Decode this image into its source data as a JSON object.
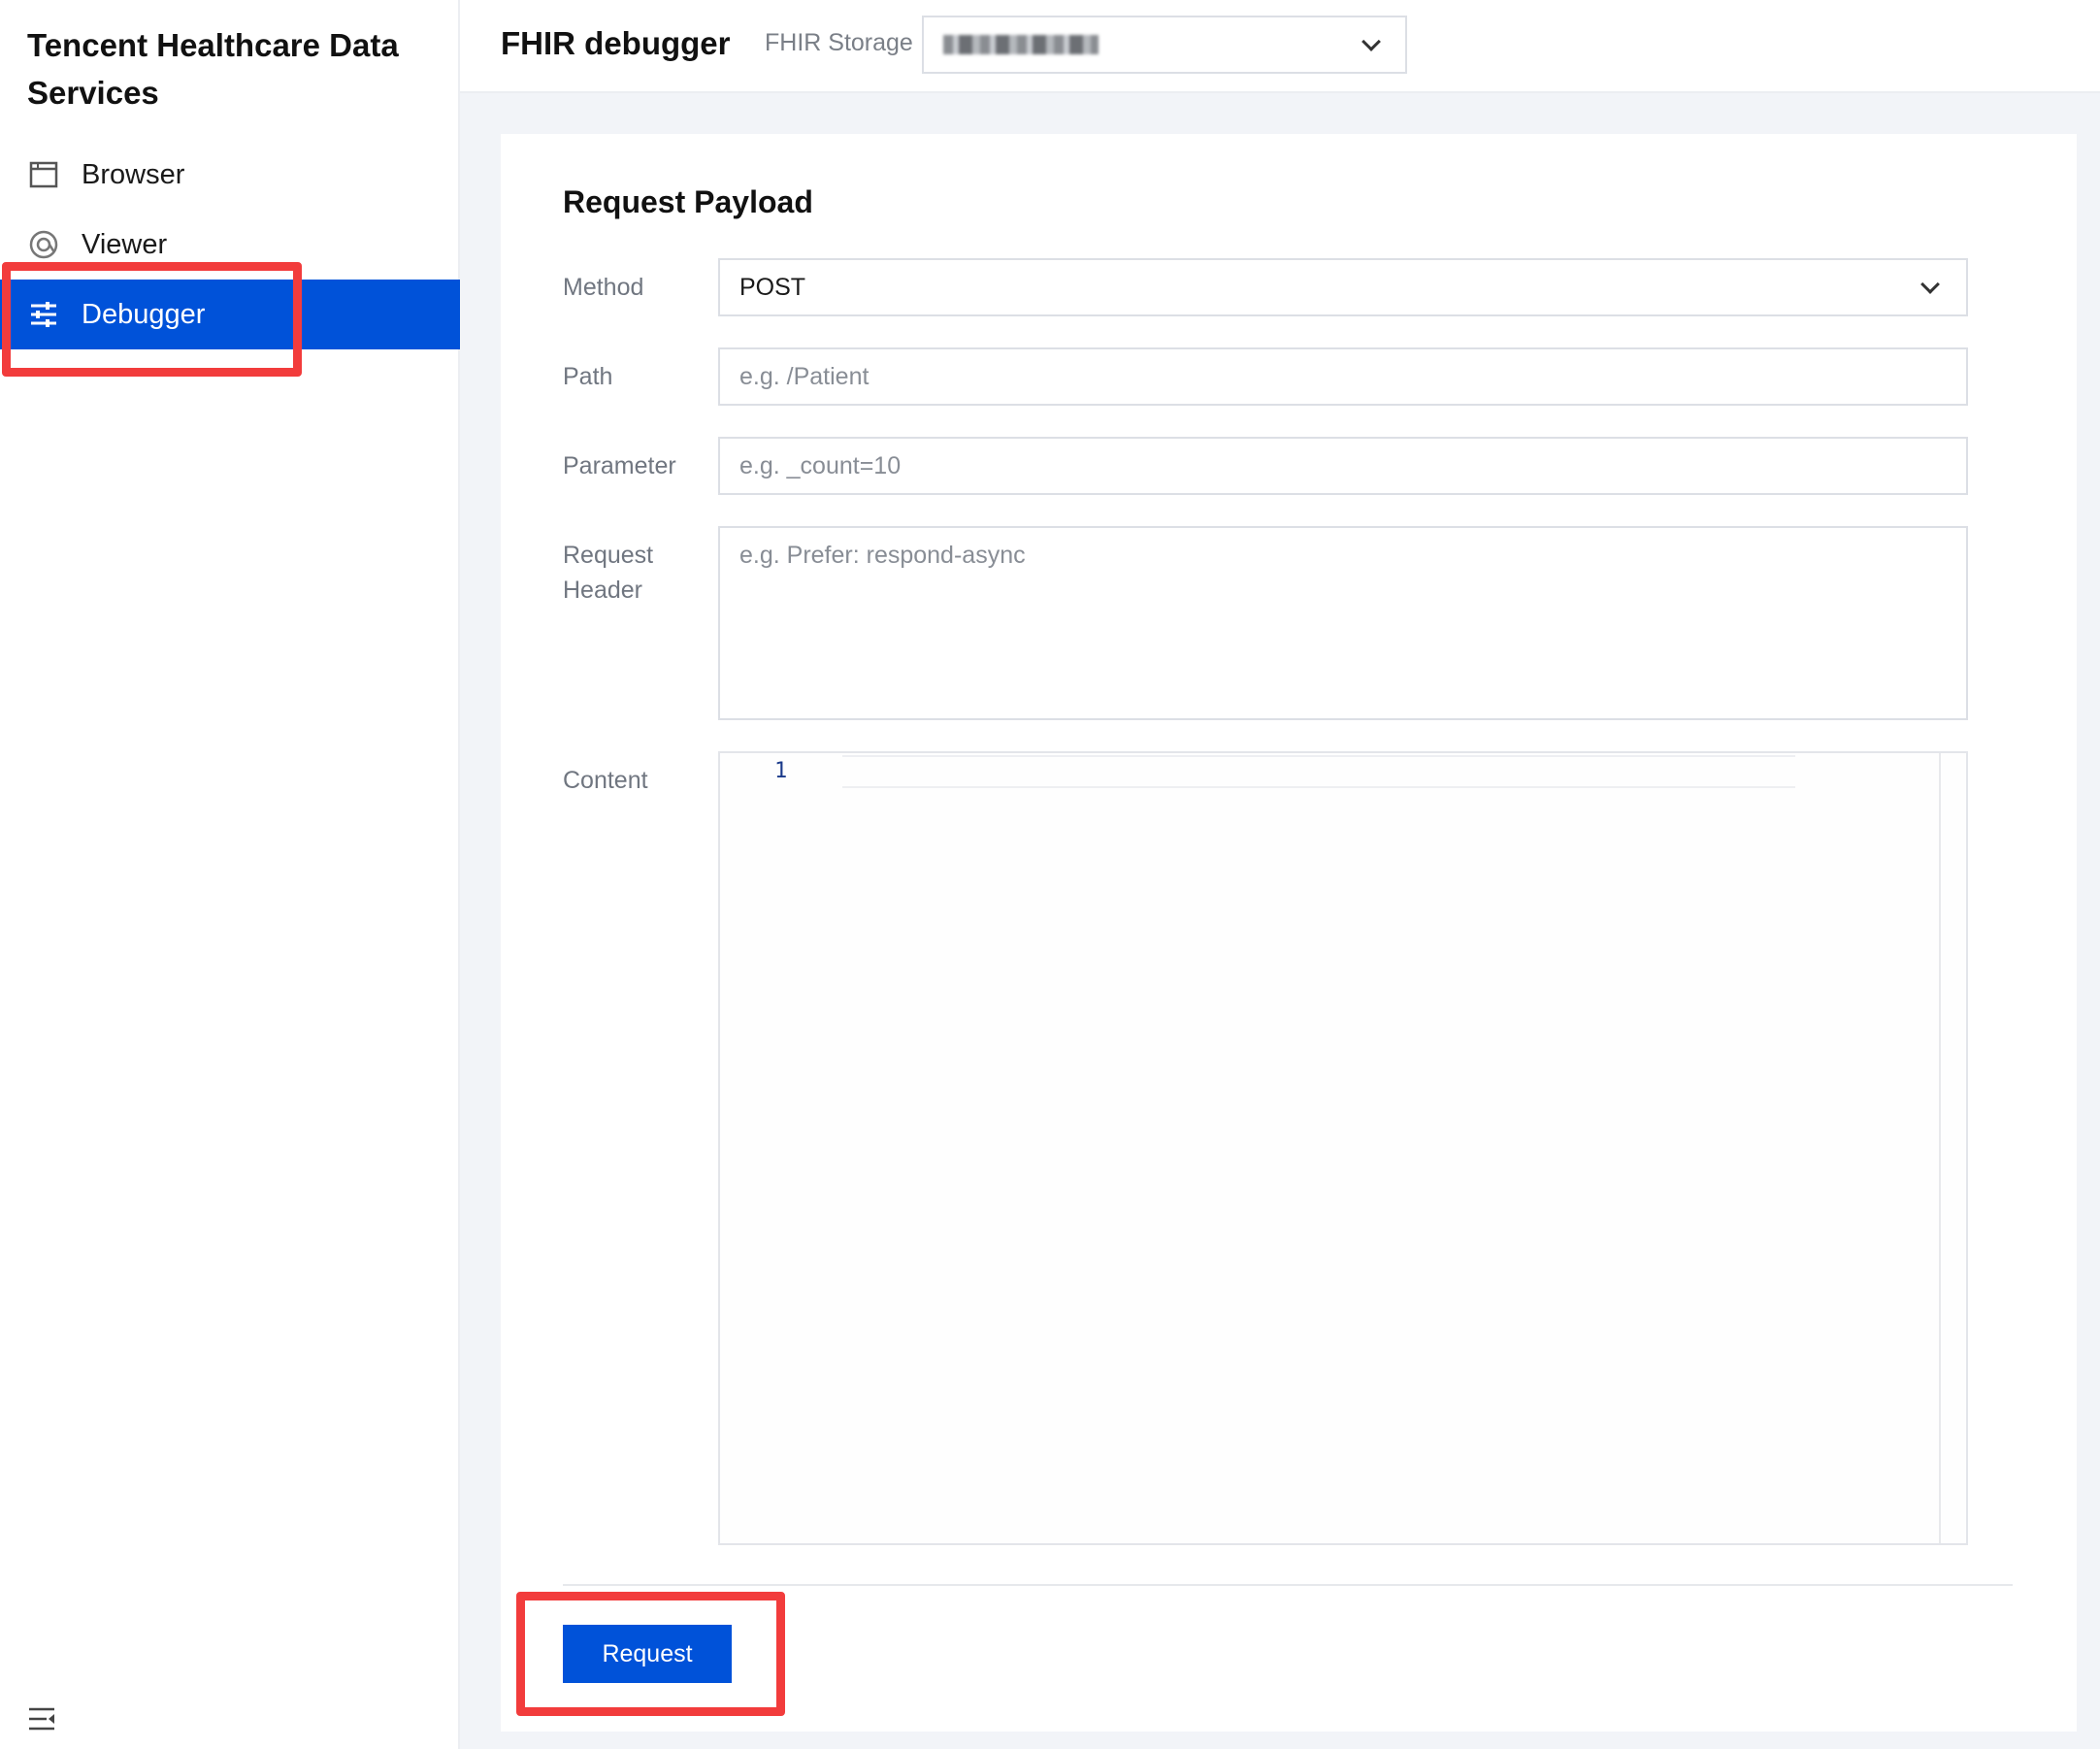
{
  "sidebar": {
    "brand": "Tencent Healthcare Data Services",
    "items": [
      {
        "label": "Browser",
        "icon": "browser-icon",
        "active": false
      },
      {
        "label": "Viewer",
        "icon": "viewer-icon",
        "active": false
      },
      {
        "label": "Debugger",
        "icon": "sliders-icon",
        "active": true
      }
    ],
    "collapse_icon": "collapse-menu-icon"
  },
  "header": {
    "title": "FHIR debugger",
    "storage_label": "FHIR Storage"
  },
  "form": {
    "section_title": "Request Payload",
    "method_label": "Method",
    "method_value": "POST",
    "path_label": "Path",
    "path_placeholder": "e.g. /Patient",
    "parameter_label": "Parameter",
    "parameter_placeholder": "e.g. _count=10",
    "header_label": "Request Header",
    "header_placeholder": "e.g. Prefer: respond-async",
    "content_label": "Content",
    "editor_line_number": "1",
    "submit_label": "Request"
  },
  "colors": {
    "accent": "#0052d9",
    "highlight": "#f23c3c",
    "background": "#f2f4f8"
  }
}
